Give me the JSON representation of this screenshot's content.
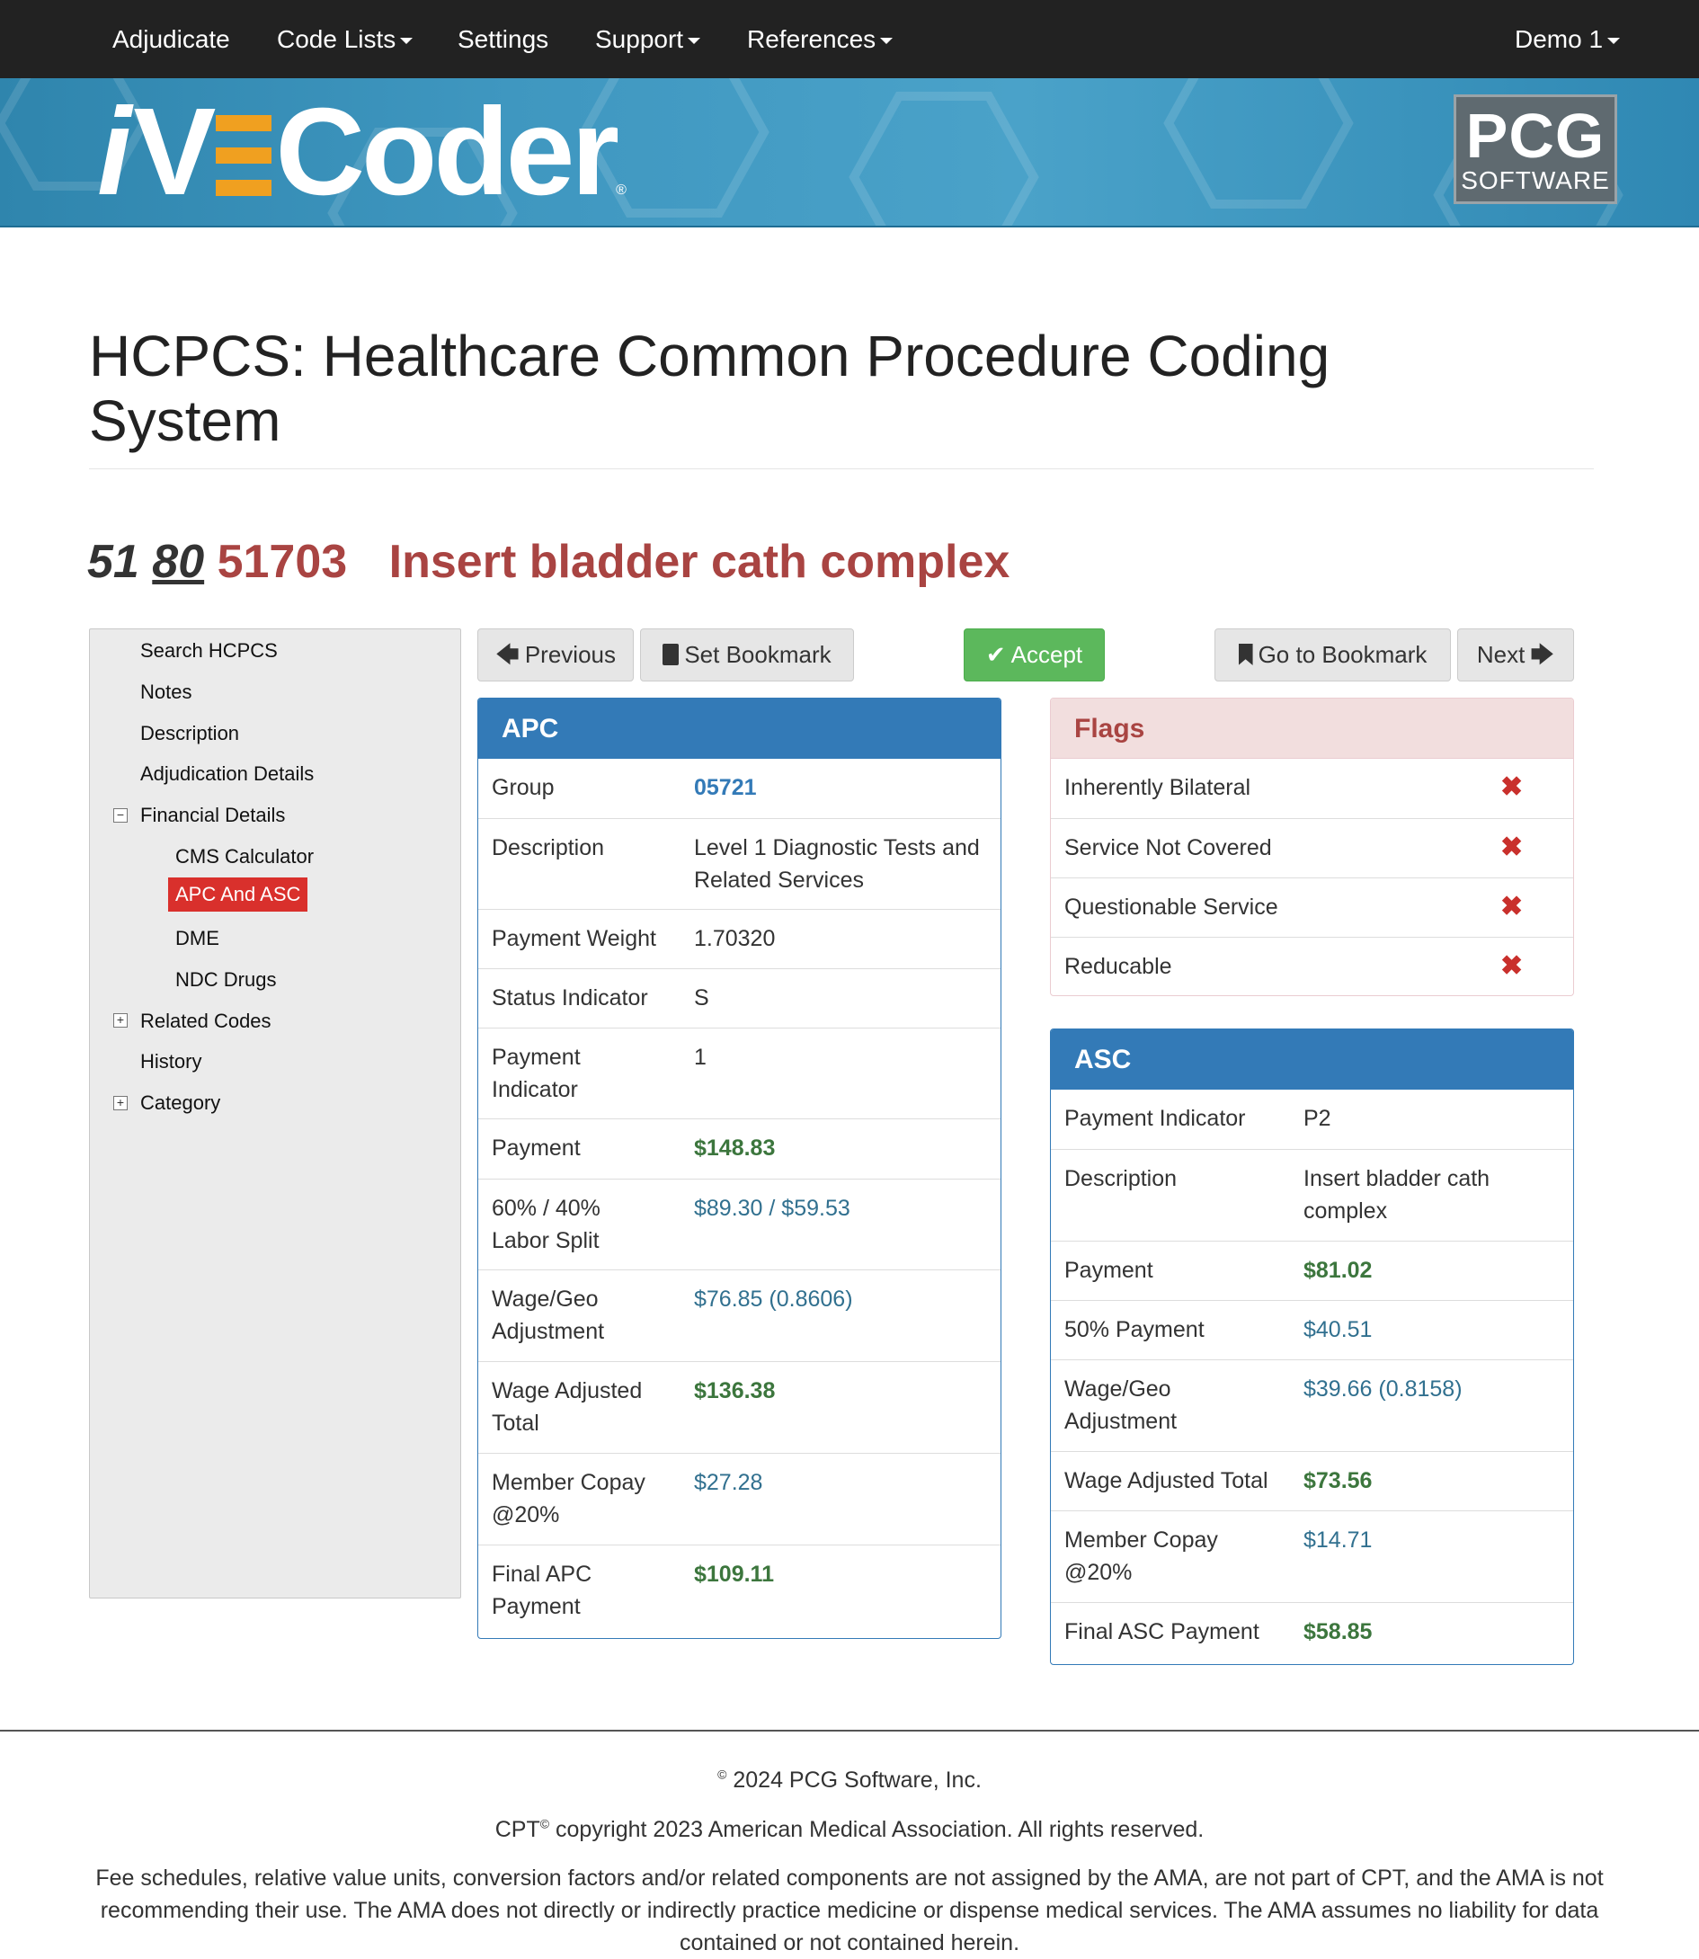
{
  "navbar": {
    "items": [
      "Adjudicate",
      "Code Lists",
      "Settings",
      "Support",
      "References"
    ],
    "user": "Demo 1"
  },
  "banner": {
    "logo_text_i": "i",
    "logo_text_v": "V",
    "logo_text_rest": "Coder",
    "logo_registered": "®",
    "pcg_big": "PCG",
    "pcg_small": "SOFTWARE"
  },
  "page": {
    "title": "HCPCS: Healthcare Common Procedure Coding System",
    "code_prefix_1": "51",
    "code_prefix_2": "80",
    "code": "51703",
    "code_desc": "Insert bladder cath complex"
  },
  "sidebar": {
    "items": [
      "Search HCPCS",
      "Notes",
      "Description",
      "Adjudication Details",
      "Financial Details",
      "CMS Calculator",
      "APC And ASC",
      "DME",
      "NDC Drugs",
      "Related Codes",
      "History",
      "Category"
    ],
    "toggle_minus": "−",
    "toggle_plus": "+"
  },
  "toolbar": {
    "previous": "Previous",
    "set_bookmark": "Set Bookmark",
    "accept": "Accept",
    "go_to_bookmark": "Go to Bookmark",
    "next": "Next"
  },
  "apc": {
    "heading": "APC",
    "rows": [
      {
        "label": "Group",
        "value": "05721"
      },
      {
        "label": "Description",
        "value": "Level 1 Diagnostic Tests and Related Services"
      },
      {
        "label": "Payment Weight",
        "value": "1.70320"
      },
      {
        "label": "Status Indicator",
        "value": "S"
      },
      {
        "label": "Payment Indicator",
        "value": "1"
      },
      {
        "label": "Payment",
        "value": "$148.83"
      },
      {
        "label": "60% / 40% Labor Split",
        "value": "$89.30 / $59.53"
      },
      {
        "label": "Wage/Geo Adjustment",
        "value": "$76.85 (0.8606)"
      },
      {
        "label": "Wage Adjusted Total",
        "value": "$136.38"
      },
      {
        "label": "Member Copay @20%",
        "value": "$27.28"
      },
      {
        "label": "Final APC Payment",
        "value": "$109.11"
      }
    ]
  },
  "flags": {
    "heading": "Flags",
    "rows": [
      "Inherently Bilateral",
      "Service Not Covered",
      "Questionable Service",
      "Reducable"
    ],
    "mark": "✖"
  },
  "asc": {
    "heading": "ASC",
    "rows": [
      {
        "label": "Payment Indicator",
        "value": "P2"
      },
      {
        "label": "Description",
        "value": "Insert bladder cath complex"
      },
      {
        "label": "Payment",
        "value": "$81.02"
      },
      {
        "label": "50% Payment",
        "value": "$40.51"
      },
      {
        "label": "Wage/Geo Adjustment",
        "value": "$39.66 (0.8158)"
      },
      {
        "label": "Wage Adjusted Total",
        "value": "$73.56"
      },
      {
        "label": "Member Copay @20%",
        "value": "$14.71"
      },
      {
        "label": "Final ASC Payment",
        "value": "$58.85"
      }
    ]
  },
  "footer": {
    "copyright_symbol": "©",
    "company": "2024 PCG Software, Inc.",
    "cpt": "CPT",
    "cpt_copyright": "copyright 2023 American Medical Association. All rights reserved.",
    "disclaimer": "Fee schedules, relative value units, conversion factors and/or related components are not assigned by the AMA, are not part of CPT, and the AMA is not recommending their use. The AMA does not directly or indirectly practice medicine or dispense medical services. The AMA assumes no liability for data contained or not contained herein."
  },
  "colors": {
    "navbar": "#222222",
    "banner": "#3f97c0",
    "logo_orange": "#f0a020",
    "panel_blue": "#337ab7",
    "accept_green": "#5cb85c",
    "active_red": "#d9302c",
    "flag_mark": "#c9302c",
    "money_green": "#3c763d"
  }
}
